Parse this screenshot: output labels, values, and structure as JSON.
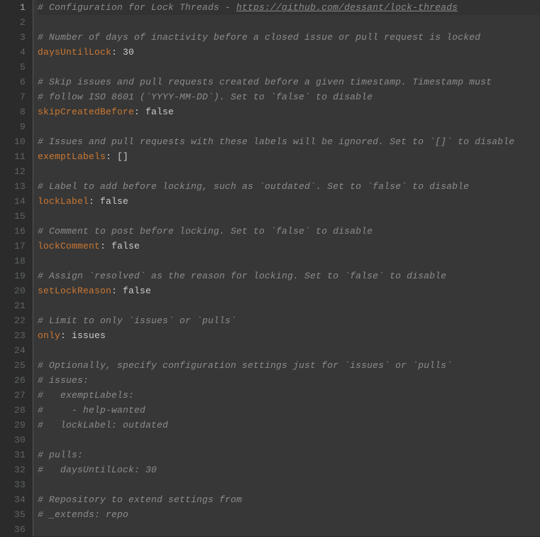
{
  "editor": {
    "total_lines": 36,
    "highlighted_line": 1,
    "lines": [
      {
        "n": 1,
        "t": "comment-link",
        "prefix": "# Configuration for Lock Threads - ",
        "url": "https://github.com/dessant/lock-threads"
      },
      {
        "n": 2,
        "t": "blank"
      },
      {
        "n": 3,
        "t": "comment",
        "text": "# Number of days of inactivity before a closed issue or pull request is locked"
      },
      {
        "n": 4,
        "t": "kv",
        "key": "daysUntilLock",
        "val": "30",
        "valClass": "num"
      },
      {
        "n": 5,
        "t": "blank"
      },
      {
        "n": 6,
        "t": "comment",
        "text": "# Skip issues and pull requests created before a given timestamp. Timestamp must"
      },
      {
        "n": 7,
        "t": "comment",
        "text": "# follow ISO 8601 (`YYYY-MM-DD`). Set to `false` to disable"
      },
      {
        "n": 8,
        "t": "kv",
        "key": "skipCreatedBefore",
        "val": "false",
        "valClass": "bool"
      },
      {
        "n": 9,
        "t": "blank"
      },
      {
        "n": 10,
        "t": "comment",
        "text": "# Issues and pull requests with these labels will be ignored. Set to `[]` to disable"
      },
      {
        "n": 11,
        "t": "kv",
        "key": "exemptLabels",
        "val": "[]",
        "valClass": "val"
      },
      {
        "n": 12,
        "t": "blank"
      },
      {
        "n": 13,
        "t": "comment",
        "text": "# Label to add before locking, such as `outdated`. Set to `false` to disable"
      },
      {
        "n": 14,
        "t": "kv",
        "key": "lockLabel",
        "val": "false",
        "valClass": "bool"
      },
      {
        "n": 15,
        "t": "blank"
      },
      {
        "n": 16,
        "t": "comment",
        "text": "# Comment to post before locking. Set to `false` to disable"
      },
      {
        "n": 17,
        "t": "kv",
        "key": "lockComment",
        "val": "false",
        "valClass": "bool"
      },
      {
        "n": 18,
        "t": "blank"
      },
      {
        "n": 19,
        "t": "comment",
        "text": "# Assign `resolved` as the reason for locking. Set to `false` to disable"
      },
      {
        "n": 20,
        "t": "kv",
        "key": "setLockReason",
        "val": "false",
        "valClass": "bool"
      },
      {
        "n": 21,
        "t": "blank"
      },
      {
        "n": 22,
        "t": "comment",
        "text": "# Limit to only `issues` or `pulls`"
      },
      {
        "n": 23,
        "t": "kv",
        "key": "only",
        "val": "issues",
        "valClass": "val"
      },
      {
        "n": 24,
        "t": "blank"
      },
      {
        "n": 25,
        "t": "comment",
        "text": "# Optionally, specify configuration settings just for `issues` or `pulls`"
      },
      {
        "n": 26,
        "t": "comment",
        "text": "# issues:"
      },
      {
        "n": 27,
        "t": "comment",
        "text": "#   exemptLabels:"
      },
      {
        "n": 28,
        "t": "comment",
        "text": "#     - help-wanted"
      },
      {
        "n": 29,
        "t": "comment",
        "text": "#   lockLabel: outdated"
      },
      {
        "n": 30,
        "t": "blank"
      },
      {
        "n": 31,
        "t": "comment",
        "text": "# pulls:"
      },
      {
        "n": 32,
        "t": "comment",
        "text": "#   daysUntilLock: 30"
      },
      {
        "n": 33,
        "t": "blank"
      },
      {
        "n": 34,
        "t": "comment",
        "text": "# Repository to extend settings from"
      },
      {
        "n": 35,
        "t": "comment",
        "text": "# _extends: repo"
      },
      {
        "n": 36,
        "t": "blank"
      }
    ],
    "colon_sep": ": "
  }
}
